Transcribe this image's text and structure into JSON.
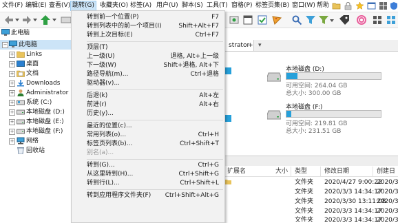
{
  "menubar": {
    "items": [
      {
        "label": "文件(F)"
      },
      {
        "label": "编辑(E)"
      },
      {
        "label": "查看(V)"
      },
      {
        "label": "跳转(G)"
      },
      {
        "label": "收藏夹(O)"
      },
      {
        "label": "标签(A)"
      },
      {
        "label": "用户(U)"
      },
      {
        "label": "脚本(S)"
      },
      {
        "label": "工具(T)"
      },
      {
        "label": "窗格(P)"
      },
      {
        "label": "标签页集(B)"
      },
      {
        "label": "窗口(W)"
      },
      {
        "label": "帮助"
      }
    ]
  },
  "address": {
    "label": "此电脑"
  },
  "tab": {
    "label": "strator",
    "add": "+",
    "dropdown": "▾"
  },
  "tree": {
    "items": [
      {
        "label": "此电脑",
        "icon": "computer-icon"
      },
      {
        "label": "Links",
        "icon": "links-folder-icon"
      },
      {
        "label": "桌面",
        "icon": "desktop-folder-icon"
      },
      {
        "label": "文档",
        "icon": "documents-folder-icon"
      },
      {
        "label": "Downloads",
        "icon": "downloads-folder-icon"
      },
      {
        "label": "Administrator",
        "icon": "user-folder-icon"
      },
      {
        "label": "系统 (C:)",
        "icon": "windows-drive-icon"
      },
      {
        "label": "本地磁盘 (D:)",
        "icon": "drive-icon"
      },
      {
        "label": "本地磁盘 (E:)",
        "icon": "drive-icon"
      },
      {
        "label": "本地磁盘 (F:)",
        "icon": "drive-icon"
      },
      {
        "label": "网络",
        "icon": "network-icon"
      },
      {
        "label": "回收站",
        "icon": "recycle-bin-icon"
      }
    ]
  },
  "drives": [
    {
      "name": "本地磁盘 (D:)",
      "free": "可用空间: 264.04 GB",
      "total": "总大小: 300.00 GB",
      "used_fraction": 0.12
    },
    {
      "name": "本地磁盘 (F:)",
      "free": "可用空间: 219.81 GB",
      "total": "总大小: 231.51 GB",
      "used_fraction": 0.05
    }
  ],
  "list": {
    "headers": [
      "扩展名",
      "大小",
      "类型",
      "修改日期",
      "创建日"
    ],
    "rows": [
      {
        "type": "文件夹",
        "modified": "2020/4/27 9:00:22",
        "created": "2020/3/1"
      },
      {
        "type": "文件夹",
        "modified": "2020/3/3 14:34:17",
        "created": "2020/3/1"
      },
      {
        "type": "文件夹",
        "modified": "2020/3/30 13:11:08",
        "created": "2020/3/1"
      },
      {
        "type": "文件夹",
        "modified": "2020/3/3 14:34:17",
        "created": "2020/3/1"
      },
      {
        "type": "文件夹",
        "modified": "2020/3/3 14:34:17",
        "created": "2020/3/1"
      },
      {
        "type": "文件夹",
        "modified": "2019/12/10 16:33:30",
        "created": "2019/12/1"
      }
    ]
  },
  "menu": {
    "items": [
      {
        "label": "转到前一个位置(P)",
        "shortcut": "F7"
      },
      {
        "label": "转到列表中的前一个项目(I)",
        "shortcut": "Shift+Alt+F7"
      },
      {
        "label": "转到上次目标(E)",
        "shortcut": "Ctrl+F7"
      },
      {
        "sep": true
      },
      {
        "label": "顶层(T)",
        "shortcut": ""
      },
      {
        "label": "上一级(U)",
        "shortcut": "退格, Alt+上一级"
      },
      {
        "label": "下一级(W)",
        "shortcut": "Shift+退格, Alt+下"
      },
      {
        "label": "路径导航(m)...",
        "shortcut": "Ctrl+退格"
      },
      {
        "label": "驱动器(v)...",
        "shortcut": ""
      },
      {
        "sep": true
      },
      {
        "label": "后退(k)",
        "shortcut": "Alt+左"
      },
      {
        "label": "前进(r)",
        "shortcut": "Alt+右"
      },
      {
        "label": "历史(y)...",
        "shortcut": ""
      },
      {
        "sep": true
      },
      {
        "label": "最近的位置(c)...",
        "shortcut": ""
      },
      {
        "label": "常用列表(o)...",
        "shortcut": "Ctrl+H"
      },
      {
        "label": "标签页列表(b)...",
        "shortcut": "Ctrl+Shift+T"
      },
      {
        "label": "别名(a)...",
        "shortcut": "",
        "disabled": true
      },
      {
        "sep": true
      },
      {
        "label": "转到(G)...",
        "shortcut": "Ctrl+G"
      },
      {
        "label": "从这里转到(H)...",
        "shortcut": "Ctrl+Shift+G"
      },
      {
        "label": "转到行(L)...",
        "shortcut": "Ctrl+Shift+L"
      },
      {
        "sep": true
      },
      {
        "label": "转到应用程序文件夹(F)",
        "shortcut": "Ctrl+Shift+Alt+G"
      }
    ]
  },
  "colors": {
    "accent": "#26a0da",
    "menu_bg": "#f2f2f2",
    "active_menu": "#cce4f7"
  }
}
